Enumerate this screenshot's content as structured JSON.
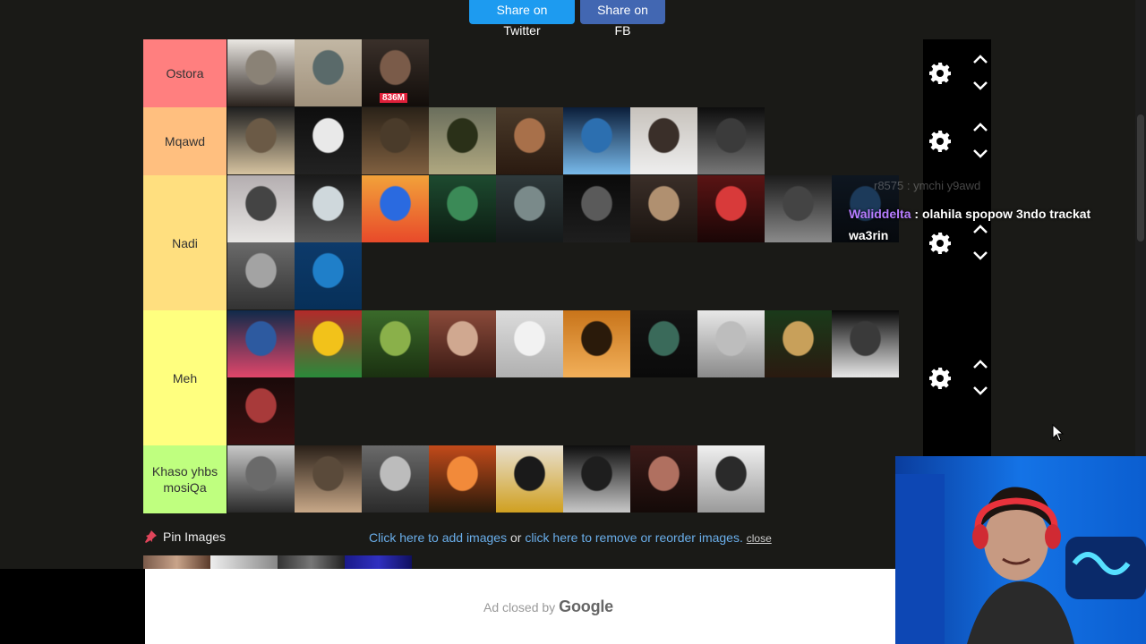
{
  "share": {
    "twitter_label": "Share on Twitter",
    "fb_label": "Share on FB"
  },
  "tiers": [
    {
      "label": "Ostora",
      "color": "#ff7f7f",
      "item_count": 3
    },
    {
      "label": "Mqawd",
      "color": "#ffbf7f",
      "item_count": 8
    },
    {
      "label": "Nadi",
      "color": "#ffdf7f",
      "item_count": 12
    },
    {
      "label": "Meh",
      "color": "#ffff7f",
      "item_count": 11
    },
    {
      "label": "Khaso yhbs mosiQa",
      "color": "#bfff7f",
      "item_count": 8
    }
  ],
  "tile_badge": "836M",
  "chat": {
    "faded_text": "r8575 : ymchi y9awd",
    "username": "Waliddelta",
    "message": " : olahila spopow 3ndo trackat wa3rin"
  },
  "pin_images_label": "Pin Images",
  "links": {
    "add_images": "Click here to add images",
    "or_text": " or ",
    "remove_reorder": "click here to remove or reorder images.",
    "close": "close"
  },
  "ad": {
    "closed_text": "Ad closed by",
    "google": "Google"
  },
  "icons": {
    "gear": "gear-icon",
    "up": "chevron-up-icon",
    "down": "chevron-down-icon",
    "pin": "pushpin-icon"
  },
  "colors": {
    "twitter": "#1d9bf0",
    "facebook": "#4267b2",
    "link": "#6aaeea",
    "chat_user": "#b77cff"
  }
}
